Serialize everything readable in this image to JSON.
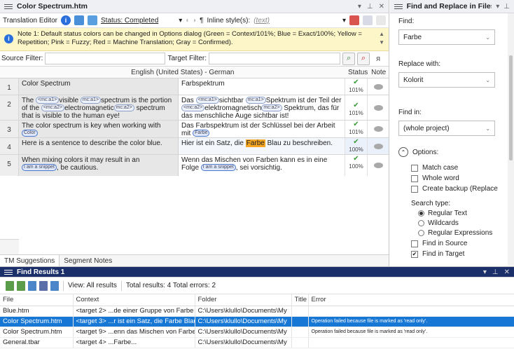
{
  "editor": {
    "title": "Color Spectrum.htm",
    "toolbar": {
      "label": "Translation Editor",
      "status_link": "Status: Completed",
      "inline_styles_label": "Inline style(s):",
      "inline_styles_value": "(text)"
    },
    "note": "Note 1: Default status colors can be changed in Options dialog (Green = Context/101%; Blue = Exact/100%; Yellow = Repetition; Pink = Fuzzy; Red = Machine Translation; Gray = Confirmed).",
    "source_filter_label": "Source Filter:",
    "target_filter_label": "Target Filter:",
    "grid_header": {
      "languages": "English (United States) - German",
      "status": "Status",
      "note": "Note"
    },
    "rows": [
      {
        "num": "1",
        "status": "101%"
      },
      {
        "num": "2",
        "status": "101%"
      },
      {
        "num": "3",
        "status": "101%"
      },
      {
        "num": "4",
        "status": "100%"
      },
      {
        "num": "5",
        "status": "100%"
      }
    ],
    "segments": {
      "s1_src": "Color Spectrum",
      "s1_tgt": "Farbspektrum",
      "s2_src_a": "The ",
      "s2_src_b": "visible ",
      "s2_src_c": "spectrum is the portion of the ",
      "s2_src_d": "electromagnetic",
      "s2_src_e": " spectrum that is visible to the human eye!",
      "s2_tgt_a": "Das ",
      "s2_tgt_b": "sichtbar ",
      "s2_tgt_c": "Spektrum ist der Teil der ",
      "s2_tgt_d": "elektromagnetisch",
      "s2_tgt_e": " Spektrum, das für das menschliche Auge sichtbar ist!",
      "s3_src": "The color spectrum is key when working with ",
      "s3_tgt": "Das Farbspektrum ist der Schlüssel bei der Arbeit mit ",
      "s4_src": "Here is a sentence to describe the color blue.",
      "s4_tgt_a": "Hier ist ein Satz, die ",
      "s4_tgt_hl": "Farbe",
      "s4_tgt_b": " Blau zu beschreiben.",
      "s5_src": "When mixing colors it may result in an ",
      "s5_src_end": ", be cautious.",
      "s5_tgt_a": "Wenn das Mischen von Farben kann es in eine Folge ",
      "s5_tgt_b": ", sei vorsichtig."
    },
    "tags": {
      "mc1_open": "<mc:a1>",
      "mc1_close": "mc:a1>",
      "mc2_open": "<mc:a2>",
      "mc2_close": "mc:a2>",
      "color": "Color",
      "farbe": "Farbe",
      "snippet": "I am a snippet"
    },
    "tabs": [
      "TM Suggestions",
      "Segment Notes"
    ]
  },
  "find_pane": {
    "title": "Find and Replace in Files",
    "find_label": "Find:",
    "find_value": "Farbe",
    "replace_label": "Replace with:",
    "replace_value": "Kolorit",
    "find_in_label": "Find in:",
    "find_in_value": "(whole project)",
    "options_label": "Options:",
    "checkboxes": [
      {
        "label": "Match case",
        "checked": false
      },
      {
        "label": "Whole word",
        "checked": false
      },
      {
        "label": "Create backup (Replace",
        "checked": false
      }
    ],
    "search_type_label": "Search type:",
    "radios": [
      {
        "label": "Regular Text",
        "selected": true
      },
      {
        "label": "Wildcards",
        "selected": false
      },
      {
        "label": "Regular Expressions",
        "selected": false
      }
    ],
    "find_in_source": {
      "label": "Find in Source",
      "checked": false
    },
    "find_in_target": {
      "label": "Find in Target",
      "checked": true
    }
  },
  "results": {
    "title": "Find Results 1",
    "view_label": "View: All results",
    "totals": "Total results: 4 Total errors: 2",
    "columns": [
      "File",
      "Context",
      "Folder",
      "Title",
      "Error"
    ],
    "rows": [
      {
        "file": "Blue.htm",
        "context": "<target 2> ...de einer Gruppe von Farbe",
        "folder": "C:\\Users\\klullo\\Documents\\My",
        "title": "",
        "error": ""
      },
      {
        "file": "Color Spectrum.htm",
        "context": "<target 3> ...r ist ein Satz, die Farbe Blau",
        "folder": "C:\\Users\\klullo\\Documents\\My",
        "title": "",
        "error": "Operation failed because file is marked as 'read only'."
      },
      {
        "file": "Color Spectrum.htm",
        "context": "<target 9> ...enn das Mischen von Farbe",
        "folder": "C:\\Users\\klullo\\Documents\\My",
        "title": "",
        "error": "Operation failed because file is marked as 'read only'."
      },
      {
        "file": "General.tbar",
        "context": "<target 4> ...Farbe...",
        "folder": "C:\\Users\\klullo\\Documents\\My",
        "title": "",
        "error": ""
      }
    ]
  }
}
